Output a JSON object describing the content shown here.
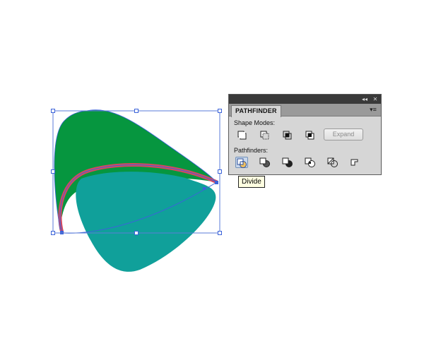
{
  "panel": {
    "tab_label": "PATHFINDER",
    "collapse_glyph": "◂◂",
    "close_glyph": "✕",
    "menu_glyph": "▾≡",
    "shape_modes_label": "Shape Modes:",
    "pathfinders_label": "Pathfinders:",
    "expand_label": "Expand",
    "shape_mode_icons": [
      "unite-icon",
      "minus-front-icon",
      "intersect-icon",
      "exclude-icon"
    ],
    "pathfinder_icons": [
      "divide-icon",
      "trim-icon",
      "merge-icon",
      "crop-icon",
      "outline-icon",
      "minus-back-icon"
    ],
    "active_pathfinder": "divide"
  },
  "tooltip": {
    "text": "Divide"
  },
  "colors": {
    "shape_green": "#06963f",
    "shape_teal": "#10a09a",
    "stroke_red": "#d6485f",
    "selection_blue": "#3b63d9",
    "panel_bg": "#d6d6d6",
    "titlebar": "#3a3a3a"
  }
}
